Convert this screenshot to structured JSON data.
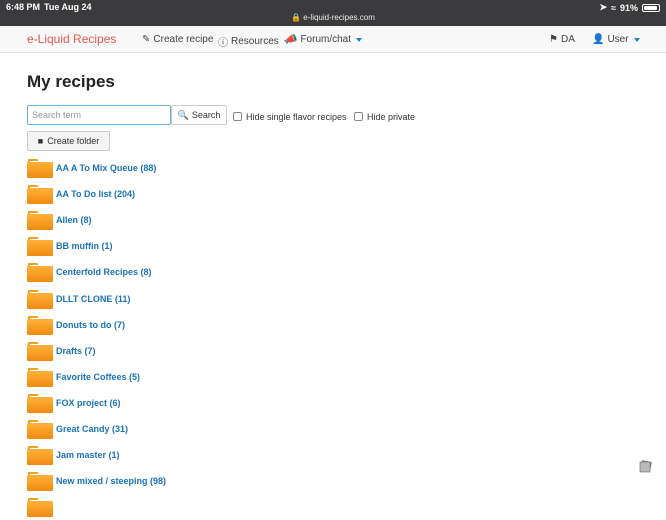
{
  "status_bar": {
    "time": "6:48 PM",
    "date": "Tue Aug 24",
    "url": "e-liquid-recipes.com",
    "battery": "91%"
  },
  "navbar": {
    "brand": "e-Liquid Recipes",
    "create_recipe": "Create recipe",
    "resources": "Resources",
    "forum": "Forum/chat",
    "language": "DA",
    "user": "User"
  },
  "page": {
    "title": "My recipes",
    "search_placeholder": "Search term",
    "search_button": "Search",
    "hide_single_flavor": "Hide single flavor recipes",
    "hide_private": "Hide private",
    "create_folder": "Create folder"
  },
  "folders": [
    "AA A To Mix Queue (88)",
    "AA To Do list (204)",
    "Allen (8)",
    "BB muffin (1)",
    "Centerfold Recipes (8)",
    "DLLT CLONE (11)",
    "Donuts to do (7)",
    "Drafts (7)",
    "Favorite Coffees (5)",
    "FOX project (6)",
    "Great Candy (31)",
    "Jam master (1)",
    "New mixed / steeping (98)"
  ],
  "colors": {
    "brand": "#e05a4e",
    "link": "#1a73b8",
    "folder": "#f5a020"
  }
}
